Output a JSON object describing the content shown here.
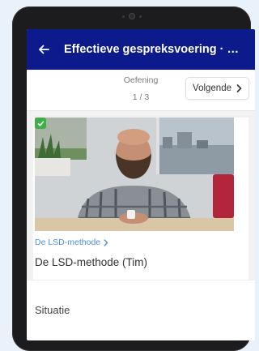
{
  "appbar": {
    "title": "Effectieve gespreksvoering · Opleiding gesprekstechnieken",
    "back_icon": "arrow-left-icon"
  },
  "exercise": {
    "label": "Oefening",
    "counter": "1 / 3",
    "next_label": "Volgende",
    "next_icon": "chevron-right-icon"
  },
  "video": {
    "completed_icon": "check-icon",
    "breadcrumb": "De LSD-methode",
    "breadcrumb_icon": "chevron-right-icon",
    "title": "De LSD-methode (Tim)"
  },
  "section": {
    "title": "Situatie"
  },
  "colors": {
    "appbar": "#0d1a8c",
    "link": "#4a90e2",
    "success": "#3cb043"
  }
}
